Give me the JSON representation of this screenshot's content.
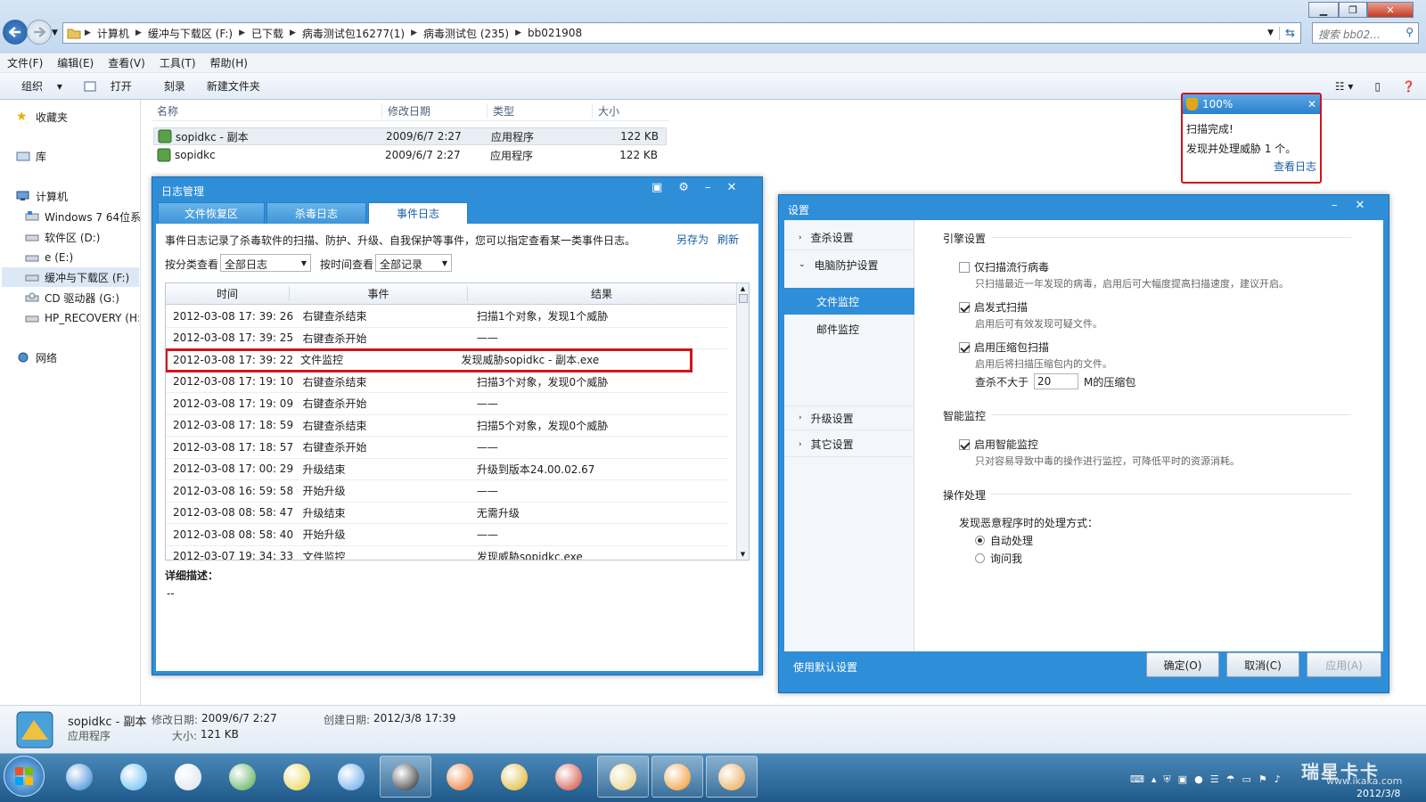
{
  "explorer": {
    "nav_buttons": {
      "back": "back-arrow-icon",
      "forward": "forward-arrow-icon"
    },
    "breadcrumbs": [
      "计算机",
      "缓冲与下载区 (F:)",
      "已下载",
      "病毒测试包16277(1)",
      "病毒测试包 (235)",
      "bb021908"
    ],
    "search_placeholder": "搜索 bb02...",
    "menu": [
      "文件(F)",
      "编辑(E)",
      "查看(V)",
      "工具(T)",
      "帮助(H)"
    ],
    "toolbar": {
      "organize": "组织",
      "open": "打开",
      "burn": "刻录",
      "new_folder": "新建文件夹"
    },
    "nav": {
      "favorites": "收藏夹",
      "libraries": "库",
      "computer": "计算机",
      "drives": [
        "Windows 7 64位系",
        "软件区 (D:)",
        "e (E:)",
        "缓冲与下载区 (F:)",
        "CD 驱动器 (G:)",
        "HP_RECOVERY (H:)"
      ],
      "network": "网络"
    },
    "columns": [
      "名称",
      "修改日期",
      "类型",
      "大小"
    ],
    "files": [
      {
        "name": "sopidkc - 副本",
        "date": "2009/6/7 2:27",
        "type": "应用程序",
        "size": "122 KB"
      },
      {
        "name": "sopidkc",
        "date": "2009/6/7 2:27",
        "type": "应用程序",
        "size": "122 KB"
      }
    ],
    "details": {
      "name": "sopidkc - 副本",
      "type": "应用程序",
      "modified_label": "修改日期:",
      "modified": "2009/6/7 2:27",
      "size_label": "大小:",
      "size": "121 KB",
      "created_label": "创建日期:",
      "created": "2012/3/8 17:39"
    }
  },
  "log_manager": {
    "title": "日志管理",
    "tabs": [
      "文件恢复区",
      "杀毒日志",
      "事件日志"
    ],
    "active_tab": 2,
    "description": "事件日志记录了杀毒软件的扫描、防护、升级、自我保护等事件，您可以指定查看某一类事件日志。",
    "links": {
      "save_as": "另存为",
      "refresh": "刷新"
    },
    "filter_category_label": "按分类查看",
    "filter_category_value": "全部日志",
    "filter_time_label": "按时间查看",
    "filter_time_value": "全部记录",
    "columns": [
      "时间",
      "事件",
      "结果"
    ],
    "rows": [
      {
        "time": "2012-03-08 17: 39: 26",
        "event": "右键查杀结束",
        "result": "扫描1个对象，发现1个威胁"
      },
      {
        "time": "2012-03-08 17: 39: 25",
        "event": "右键查杀开始",
        "result": "——"
      },
      {
        "time": "2012-03-08 17: 39: 22",
        "event": "文件监控",
        "result": "发现威胁sopidkc - 副本.exe",
        "highlighted": true
      },
      {
        "time": "2012-03-08 17: 19: 10",
        "event": "右键查杀结束",
        "result": "扫描3个对象，发现0个威胁"
      },
      {
        "time": "2012-03-08 17: 19: 09",
        "event": "右键查杀开始",
        "result": "——"
      },
      {
        "time": "2012-03-08 17: 18: 59",
        "event": "右键查杀结束",
        "result": "扫描5个对象，发现0个威胁"
      },
      {
        "time": "2012-03-08 17: 18: 57",
        "event": "右键查杀开始",
        "result": "——"
      },
      {
        "time": "2012-03-08 17: 00: 29",
        "event": "升级结束",
        "result": "升级到版本24.00.02.67"
      },
      {
        "time": "2012-03-08 16: 59: 58",
        "event": "开始升级",
        "result": "——"
      },
      {
        "time": "2012-03-08 08: 58: 47",
        "event": "升级结束",
        "result": "无需升级"
      },
      {
        "time": "2012-03-08 08: 58: 40",
        "event": "开始升级",
        "result": "——"
      },
      {
        "time": "2012-03-07 19: 34: 33",
        "event": "文件监控",
        "result": "发现威胁sopidkc.exe"
      }
    ],
    "detail_label": "详细描述：",
    "detail_value": "--",
    "highlight_color": "#d0141b"
  },
  "notification": {
    "percent": "100%",
    "line1": "扫描完成!",
    "line2": "发现并处理威胁  1 个。",
    "link": "查看日志"
  },
  "settings": {
    "title": "设置",
    "sidebar": [
      {
        "label": "查杀设置",
        "level": 0
      },
      {
        "label": "电脑防护设置",
        "level": 0,
        "expanded": true
      },
      {
        "label": "文件监控",
        "level": 1,
        "selected": true
      },
      {
        "label": "邮件监控",
        "level": 1
      },
      {
        "label": "升级设置",
        "level": 0
      },
      {
        "label": "其它设置",
        "level": 0
      }
    ],
    "engine_heading": "引擎设置",
    "options": [
      {
        "label": "仅扫描流行病毒",
        "checked": false,
        "desc": "只扫描最近一年发现的病毒，启用后可大幅度提高扫描速度，建议开启。"
      },
      {
        "label": "启发式扫描",
        "checked": true,
        "desc": "启用后可有效发现可疑文件。"
      },
      {
        "label": "启用压缩包扫描",
        "checked": true,
        "desc": "启用后将扫描压缩包内的文件。"
      }
    ],
    "zip_limit_prefix": "查杀不大于",
    "zip_limit_value": "20",
    "zip_limit_suffix": "M的压缩包",
    "smart_heading": "智能监控",
    "smart_option": {
      "label": "启用智能监控",
      "checked": true,
      "desc": "只对容易导致中毒的操作进行监控，可降低平时的资源消耗。"
    },
    "action_heading": "操作处理",
    "action_prompt": "发现恶意程序时的处理方式：",
    "radios": [
      {
        "label": "自动处理",
        "selected": true
      },
      {
        "label": "询问我",
        "selected": false
      }
    ],
    "default_link": "使用默认设置",
    "buttons": {
      "ok": "确定(O)",
      "cancel": "取消(C)",
      "apply": "应用(A)"
    }
  },
  "taskbar": {
    "apps": [
      "ie-icon",
      "qq-bubble-icon",
      "calculator-icon",
      "network-globe-icon",
      "fruit-icon",
      "bird-icon",
      "qq-penguin-icon",
      "firefox-icon",
      "shield-icon",
      "chrome-icon",
      "explorer-folder-icon",
      "orange-square-icon",
      "gear-icon"
    ],
    "watermark": "瑞星卡卡",
    "watermark_url": "www.ikaka.com",
    "date": "2012/3/8"
  }
}
